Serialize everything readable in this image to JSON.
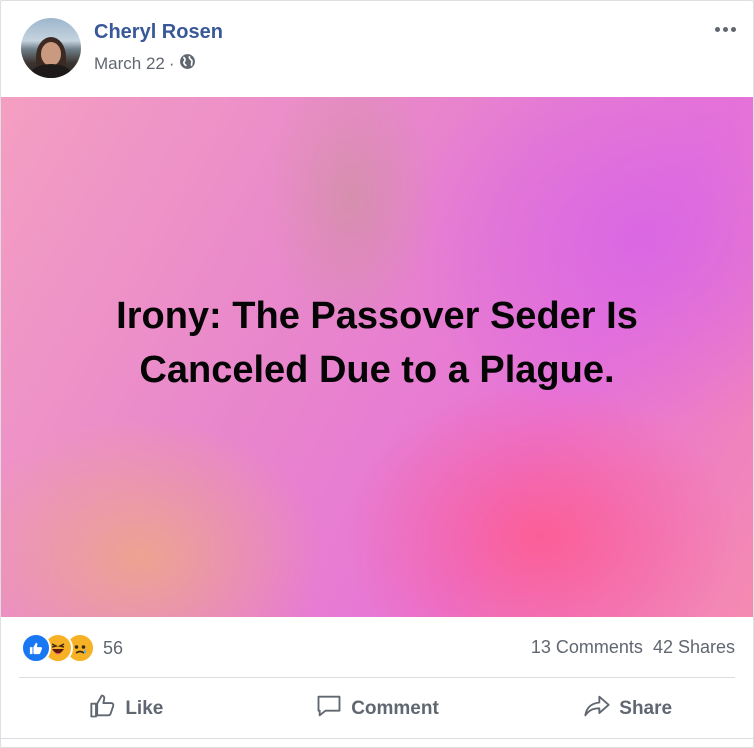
{
  "post": {
    "author": "Cheryl Rosen",
    "date": "March 22",
    "separator": "·",
    "privacy_icon": "globe-icon",
    "more_icon": "more-horizontal-icon",
    "text": "Irony: The Passover Seder Is Canceled Due to a Plague."
  },
  "engagement": {
    "reactions": [
      "like-reaction-icon",
      "haha-reaction-icon",
      "sad-reaction-icon"
    ],
    "reaction_count": "56",
    "comments": "13 Comments",
    "shares": "42 Shares"
  },
  "actions": {
    "like": "Like",
    "comment": "Comment",
    "share": "Share"
  },
  "colors": {
    "author": "#385898",
    "meta": "#606770",
    "like_blue": "#1877f2",
    "reaction_yellow": "#f7b125"
  }
}
